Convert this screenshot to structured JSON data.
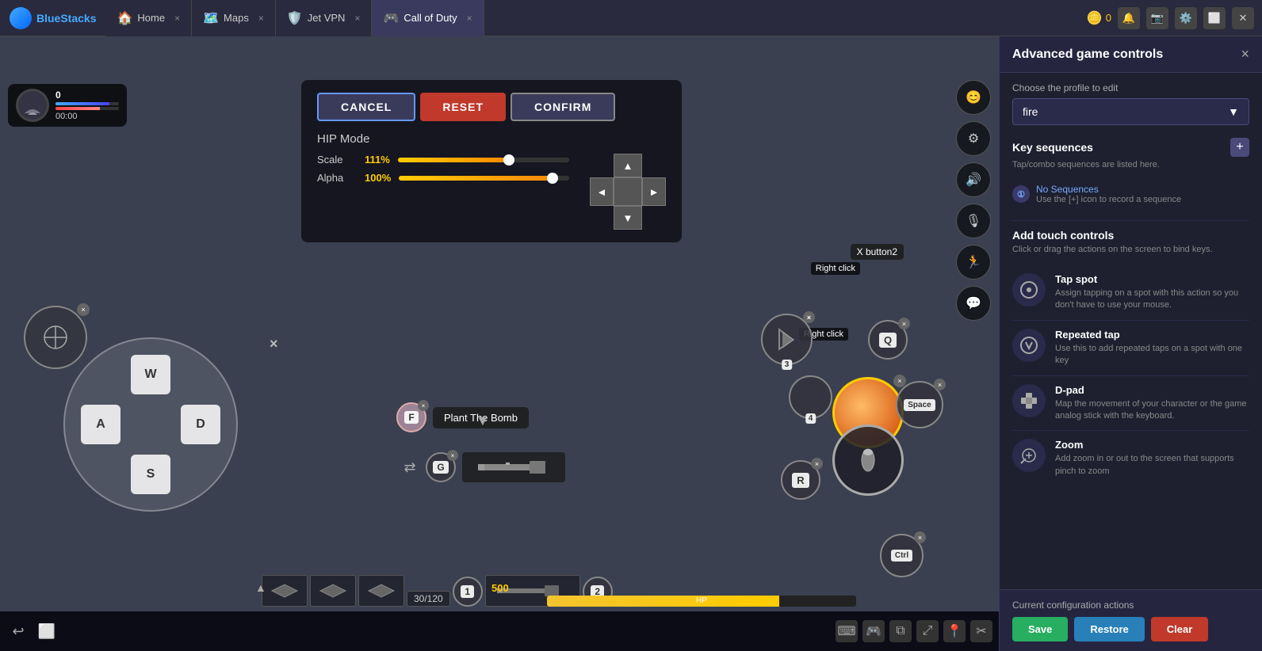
{
  "app": {
    "name": "BlueStacks",
    "tabs": [
      {
        "id": "home",
        "label": "Home",
        "active": false
      },
      {
        "id": "maps",
        "label": "Maps",
        "active": false
      },
      {
        "id": "jetvpn",
        "label": "Jet VPN",
        "active": false
      },
      {
        "id": "callofduty",
        "label": "Call of Duty",
        "active": true
      }
    ],
    "coins": "0"
  },
  "panel": {
    "title": "Advanced game controls",
    "close_label": "×",
    "profile_label": "Choose the profile to edit",
    "profile_value": "fire",
    "key_sequences_title": "Key sequences",
    "key_sequences_desc": "Tap/combo sequences are listed here.",
    "no_sequence_label": "No Sequences",
    "no_sequence_desc": "Use the [+] icon to record a sequence",
    "add_touch_title": "Add touch controls",
    "add_touch_desc": "Click or drag the actions on the screen to bind keys.",
    "controls": [
      {
        "id": "tap-spot",
        "title": "Tap spot",
        "desc": "Assign tapping on a spot with this action so you don't have to use your mouse."
      },
      {
        "id": "repeated-tap",
        "title": "Repeated tap",
        "desc": "Use this to add repeated taps on a spot with one key"
      },
      {
        "id": "d-pad",
        "title": "D-pad",
        "desc": "Map the movement of your character or the game analog stick with the keyboard."
      },
      {
        "id": "zoom",
        "title": "Zoom",
        "desc": "Add zoom in or out to the screen that supports pinch to zoom"
      }
    ],
    "footer": {
      "label": "Current configuration actions",
      "save": "Save",
      "restore": "Restore",
      "clear": "Clear"
    }
  },
  "game": {
    "mode_label": "HIP Mode",
    "scale_label": "Scale",
    "scale_value": "111%",
    "alpha_label": "Alpha",
    "alpha_value": "100%",
    "cancel_btn": "CANCEL",
    "reset_btn": "RESET",
    "confirm_btn": "CONFIRM",
    "keys": {
      "w": "W",
      "a": "A",
      "s": "S",
      "d": "D",
      "f": "F",
      "g": "G",
      "r": "R",
      "q": "Q",
      "space": "Space",
      "ctrl": "Ctrl",
      "right_click": "Right click",
      "x_button": "X button2",
      "slot1": "1",
      "slot2": "2",
      "slot3": "3",
      "slot4": "4"
    },
    "plant_bomb": "Plant The Bomb",
    "hp_label": "HP",
    "hp_value": "500",
    "ammo": "30/120",
    "timer": "00:00",
    "score": "0"
  }
}
